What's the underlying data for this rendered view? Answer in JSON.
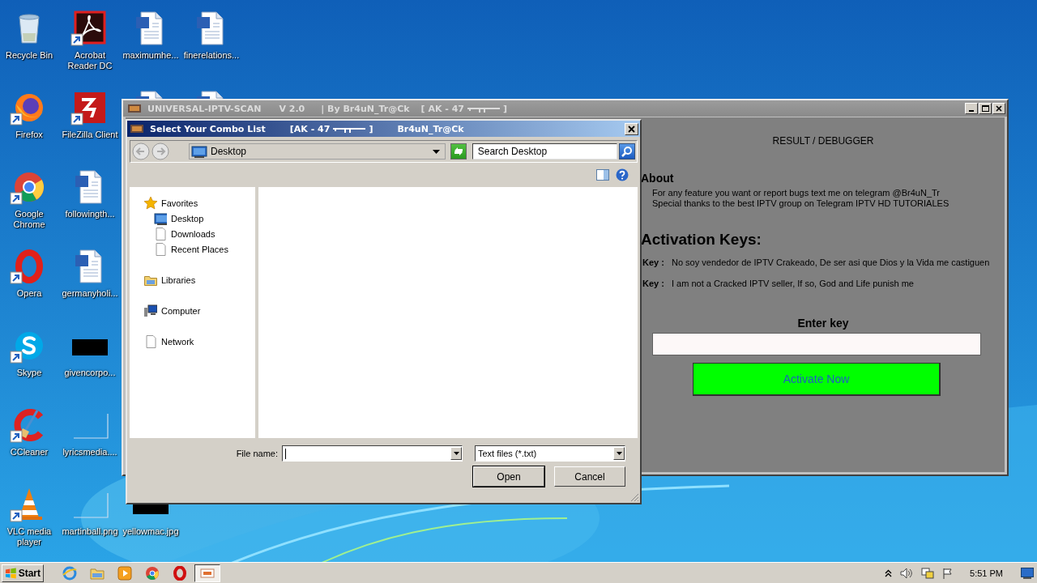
{
  "desktop": {
    "columns": [
      [
        {
          "label": "Recycle Bin",
          "kind": "recycle-bin",
          "shortcut": false
        },
        {
          "label": "Firefox",
          "kind": "firefox",
          "shortcut": true
        },
        {
          "label": "Google Chrome",
          "kind": "chrome",
          "shortcut": true
        },
        {
          "label": "Opera",
          "kind": "opera",
          "shortcut": true
        },
        {
          "label": "Skype",
          "kind": "skype",
          "shortcut": true
        },
        {
          "label": "CCleaner",
          "kind": "ccleaner",
          "shortcut": true
        },
        {
          "label": "VLC media player",
          "kind": "vlc",
          "shortcut": true
        }
      ],
      [
        {
          "label": "Acrobat Reader DC",
          "kind": "acrobat",
          "shortcut": true
        },
        {
          "label": "FileZilla Client",
          "kind": "filezilla",
          "shortcut": true
        },
        {
          "label": "followingth...",
          "kind": "word",
          "shortcut": false
        },
        {
          "label": "germanyholi...",
          "kind": "word",
          "shortcut": false
        },
        {
          "label": "givencorpo...",
          "kind": "dark-image",
          "shortcut": false
        },
        {
          "label": "lyricsmedia....",
          "kind": "blank-image",
          "shortcut": false
        },
        {
          "label": "martinball.png",
          "kind": "blank-image",
          "shortcut": false
        }
      ],
      [
        {
          "label": "maximumhe...",
          "kind": "word",
          "shortcut": false
        },
        {
          "kind": "word"
        },
        {
          "label": "yellowmac.jpg",
          "kind": "dark-image",
          "shortcut": false
        }
      ],
      [
        {
          "label": "finerelations...",
          "kind": "word",
          "shortcut": false
        },
        {
          "kind": "word"
        }
      ]
    ]
  },
  "app_window": {
    "title": "UNIVERSAL-IPTV-SCAN",
    "version": "V 2.0",
    "author": "| By Br4uN_Tr@Ck",
    "tag_open": "[ AK - 47",
    "tag_close": "]"
  },
  "panel": {
    "heading": "RESULT / DEBUGGER",
    "about_title": "About",
    "about_lines": [
      "For any feature you want or report bugs text me on telegram @Br4uN_Tr",
      "Special thanks to the best IPTV group on Telegram IPTV HD TUTORIALES"
    ],
    "keys_title": "Activation Keys:",
    "keys": [
      {
        "label": "Key :",
        "text": "No soy vendedor de IPTV Crakeado, De ser asi que Dios y la Vida me castiguen"
      },
      {
        "label": "Key :",
        "text": "I am not a Cracked IPTV seller, If so, God and Life punish me"
      }
    ],
    "enter_label": "Enter key",
    "activate_button": "Activate Now"
  },
  "dialog": {
    "title": "Select Your Combo List",
    "tag_open": "[AK - 47",
    "tag_close": "]",
    "author": "Br4uN_Tr@Ck",
    "address": "Desktop",
    "search": {
      "placeholder": "Search Desktop"
    },
    "nav": [
      {
        "label": "Favorites",
        "kind": "favorites",
        "selected": false,
        "children": [
          {
            "label": "Desktop",
            "kind": "desktop",
            "selected": false
          },
          {
            "label": "Downloads",
            "kind": "page",
            "selected": false
          },
          {
            "label": "Recent Places",
            "kind": "page",
            "selected": false
          }
        ]
      },
      {
        "label": "Libraries",
        "kind": "libraries",
        "selected": false
      },
      {
        "label": "Computer",
        "kind": "computer",
        "selected": false
      },
      {
        "label": "Network",
        "kind": "page",
        "selected": false
      }
    ],
    "file_name_label": "File name:",
    "file_type": "Text files (*.txt)",
    "buttons": [
      "Open",
      "Cancel"
    ]
  },
  "taskbar": {
    "start": "Start",
    "pinned": [
      {
        "kind": "ie",
        "active": false
      },
      {
        "kind": "folder",
        "active": false
      },
      {
        "kind": "media",
        "active": false
      },
      {
        "kind": "chrome",
        "active": false
      },
      {
        "kind": "opera",
        "active": false
      },
      {
        "kind": "app",
        "active": true
      }
    ],
    "clock": "5:51 PM"
  }
}
